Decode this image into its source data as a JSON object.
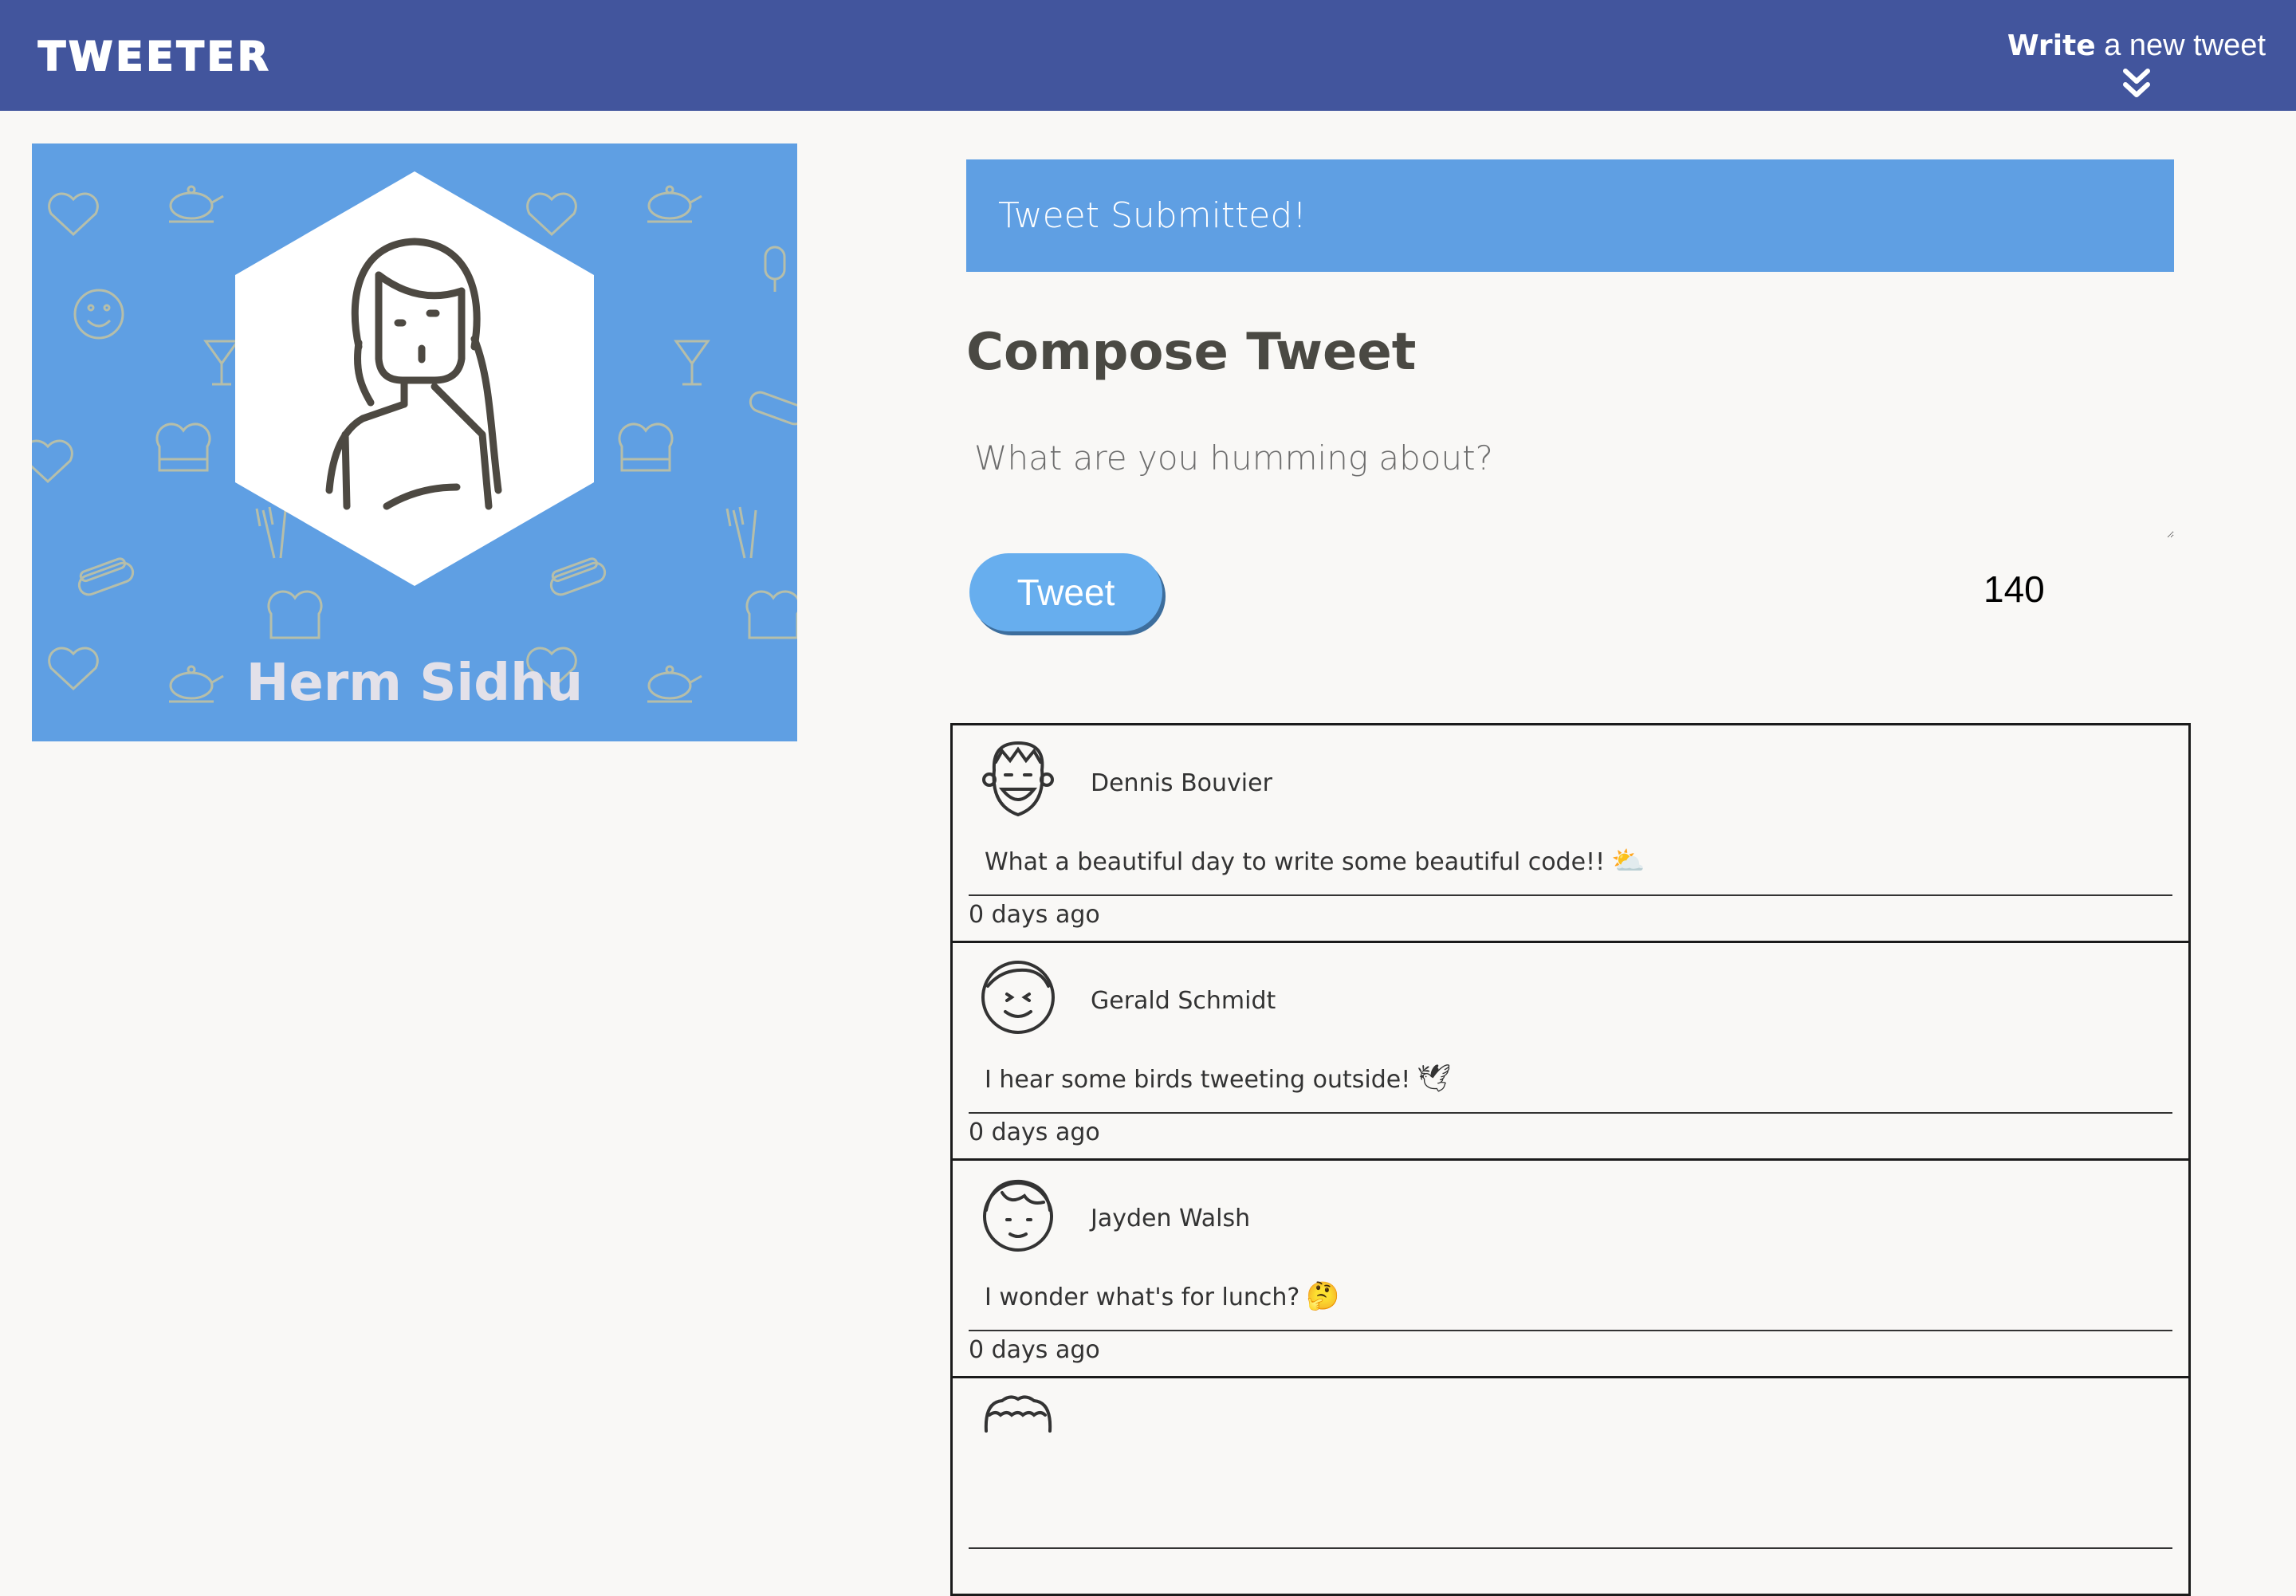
{
  "nav": {
    "brand": "TWEETER",
    "write_bold": "Write",
    "write_rest": " a new tweet"
  },
  "profile": {
    "name": "Herm Sidhu"
  },
  "flash": "Tweet Submitted!",
  "compose": {
    "title": "Compose Tweet",
    "placeholder": "What are you humming about?",
    "button": "Tweet",
    "counter": "140"
  },
  "tweets": [
    {
      "author": "Dennis Bouvier",
      "text": "What a beautiful day to write some beautiful code!!",
      "emoji": "⛅",
      "time": "0 days ago"
    },
    {
      "author": "Gerald Schmidt",
      "text": "I hear some birds tweeting outside!",
      "emoji": "🕊",
      "time": "0 days ago"
    },
    {
      "author": "Jayden Walsh",
      "text": "I wonder what's for lunch?",
      "emoji": "🤔",
      "time": "0 days ago"
    },
    {
      "author": "",
      "text": "",
      "emoji": "",
      "time": ""
    }
  ],
  "colors": {
    "nav": "#42559d",
    "accent": "#5f9fe3",
    "button": "#67aeee",
    "background": "#f9f8f6"
  },
  "icons": [
    "chevron-double-down-icon",
    "profile-avatar-icon",
    "user-avatar-icon",
    "pattern-icons"
  ]
}
